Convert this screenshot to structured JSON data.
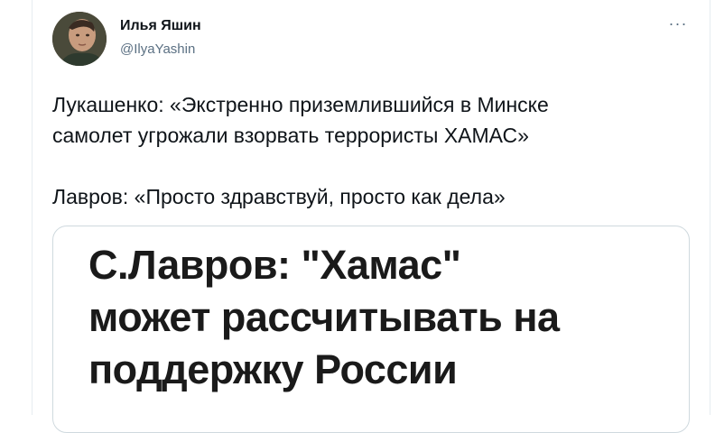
{
  "author": {
    "name": "Илья Яшин",
    "handle": "@IlyaYashin",
    "avatar_icon": "user-avatar-photo"
  },
  "more_icon": "more-options-icon",
  "more_label": "···",
  "tweet": {
    "line1": "Лукашенко: «Экстренно приземлившийся в Минске",
    "line2": "самолет угрожали взорвать террористы ХАМАС»",
    "line3": "Лавров: «Просто здравствуй, просто как дела»"
  },
  "card": {
    "headline_line1": "С.Лавров: \"Хамас\"",
    "headline_line2": "может рассчитывать на",
    "headline_line3": "поддержку России"
  },
  "colors": {
    "text": "#0f1419",
    "secondary": "#5b7083",
    "border": "#cfd9de"
  }
}
